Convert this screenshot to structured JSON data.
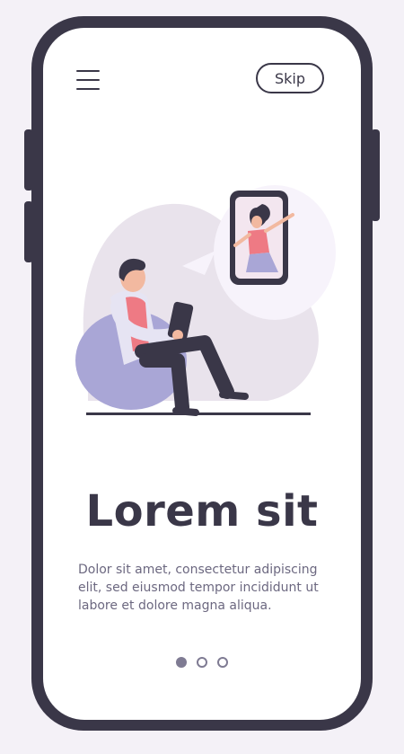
{
  "header": {
    "menu_icon": "hamburger-menu-icon",
    "skip_label": "Skip"
  },
  "illustration": {
    "description_icon": "video-call-illustration"
  },
  "content": {
    "title": "Lorem sit",
    "body": "Dolor sit amet, consectetur adipiscing elit, sed eiusmod tempor incididunt ut labore et dolore magna aliqua."
  },
  "pagination": {
    "current": 1,
    "total": 3
  },
  "colors": {
    "frame": "#3a3748",
    "background": "#f4f1f7",
    "accent_pink": "#ee7a84",
    "chair": "#a9a6d6",
    "blob": "#e9e3ec"
  }
}
